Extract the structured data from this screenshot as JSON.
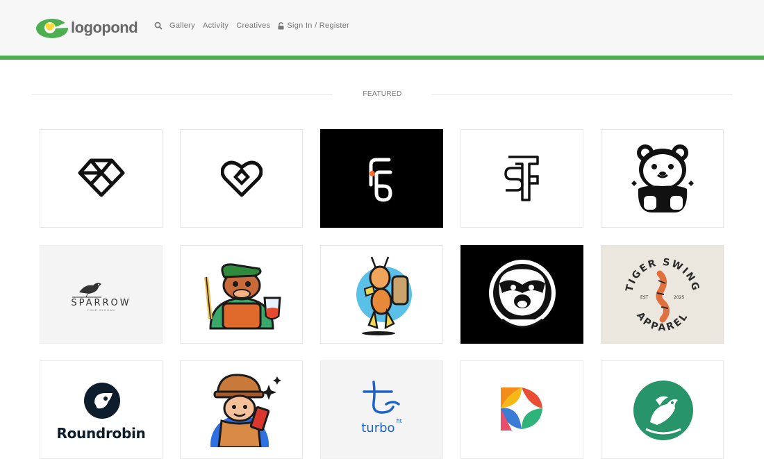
{
  "header": {
    "brand": "logopond",
    "nav": [
      {
        "label": "Gallery"
      },
      {
        "label": "Activity"
      },
      {
        "label": "Creatives"
      }
    ],
    "signin_label": "Sign In / Register"
  },
  "section": {
    "featured_label": "FEATURED"
  },
  "colors": {
    "accent_green": "#4caf50",
    "header_bg": "#f7f7f7"
  },
  "cards": {
    "sparrow_name": "SPARROW",
    "sparrow_slogan": "YOUR SLOGAN",
    "tiger_top": "TIGER SWING",
    "tiger_bottom": "APPAREL",
    "tiger_est": "EST",
    "tiger_year": "2025",
    "roundrobin_name": "Roundrobin",
    "turbo_name": "turbo",
    "turbo_sup": "fit"
  }
}
